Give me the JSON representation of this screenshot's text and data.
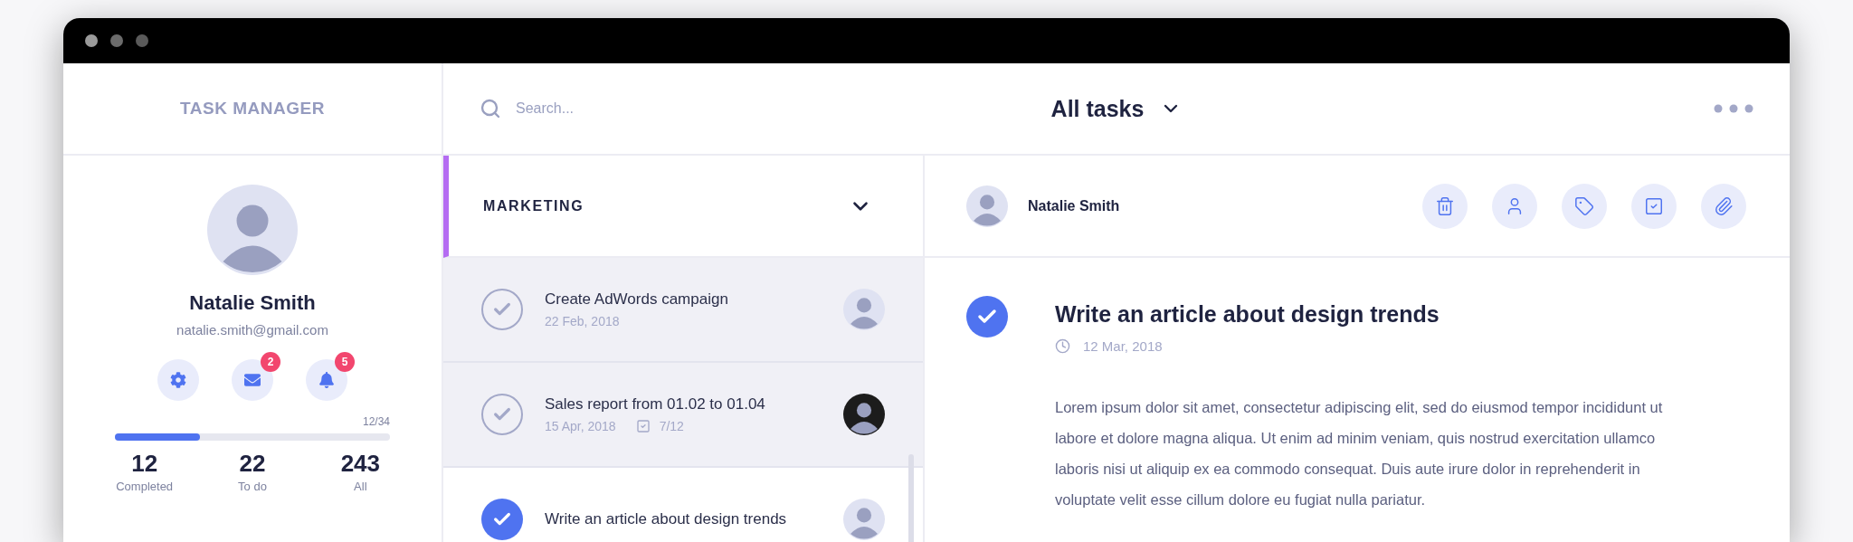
{
  "sidebar": {
    "title": "TASK MANAGER",
    "profile": {
      "name": "Natalie Smith",
      "email": "natalie.smith@gmail.com"
    },
    "actions": [
      {
        "kind": "settings"
      },
      {
        "kind": "mail",
        "badge": "2"
      },
      {
        "kind": "notifications",
        "badge": "5"
      }
    ],
    "progress": {
      "reading": "12/34",
      "level": 0.31
    },
    "stats": [
      {
        "value": "12",
        "label": "Completed"
      },
      {
        "value": "22",
        "label": "To do"
      },
      {
        "value": "243",
        "label": "All"
      }
    ]
  },
  "toolbar": {
    "search": {
      "placeholder": "Search..."
    },
    "filter": "All tasks"
  },
  "task_list": {
    "group": "MARKETING",
    "tasks": [
      {
        "title": "Create AdWords campaign",
        "date": "22 Feb, 2018",
        "checked": false,
        "selected": false,
        "assignee": {
          "color": "#dfe2f2"
        }
      },
      {
        "title": "Sales report from 01.02 to 01.04",
        "date": "15 Apr, 2018",
        "subtasks": "7/12",
        "checked": false,
        "selected": false,
        "assignee": {
          "color": "#1c1c1c"
        }
      },
      {
        "title": "Write an article about design trends",
        "checked": true,
        "selected": true,
        "assignee": {
          "color": "#dfe2f2"
        }
      }
    ]
  },
  "detail": {
    "assignee": "Natalie Smith",
    "actions": [
      {
        "kind": "delete"
      },
      {
        "kind": "assign"
      },
      {
        "kind": "tag"
      },
      {
        "kind": "checklist"
      },
      {
        "kind": "attach"
      }
    ],
    "task": {
      "title": "Write an article about design trends",
      "date": "12 Mar, 2018",
      "checked": true,
      "description": "Lorem ipsum dolor sit amet, consectetur adipiscing elit, sed do eiusmod tempor incididunt ut labore et dolore magna aliqua. Ut enim ad minim veniam, quis nostrud exercitation ullamco laboris nisi ut aliquip ex ea commodo consequat. Duis aute irure dolor in reprehenderit in voluptate velit esse cillum dolore eu fugiat nulla pariatur."
    }
  }
}
